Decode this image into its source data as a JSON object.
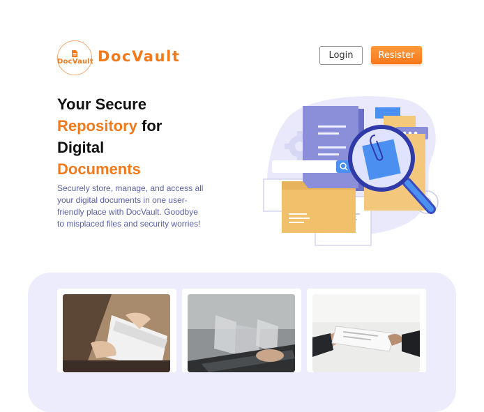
{
  "brand": {
    "logo_small_text": "DocVault",
    "name": "DocVault",
    "accent_color": "#f27a1a",
    "icon": "document-icon"
  },
  "nav": {
    "login_label": "Login",
    "register_label": "Resister"
  },
  "hero": {
    "title_line1": "Your Secure",
    "title_highlight1": "Repository",
    "title_word_for": "for",
    "title_line3": "Digital",
    "title_highlight2": "Documents",
    "description": "Securely store, manage, and access all your digital documents in one user-friendly place with DocVault. Goodbye to misplaced files and security worries!",
    "illustration": "document-search-illustration"
  },
  "gallery": {
    "band_color": "#ececfd",
    "cards": [
      {
        "image": "hands-holding-papers-photo"
      },
      {
        "image": "laptop-typing-documents-photo"
      },
      {
        "image": "handing-over-document-photo"
      }
    ]
  }
}
